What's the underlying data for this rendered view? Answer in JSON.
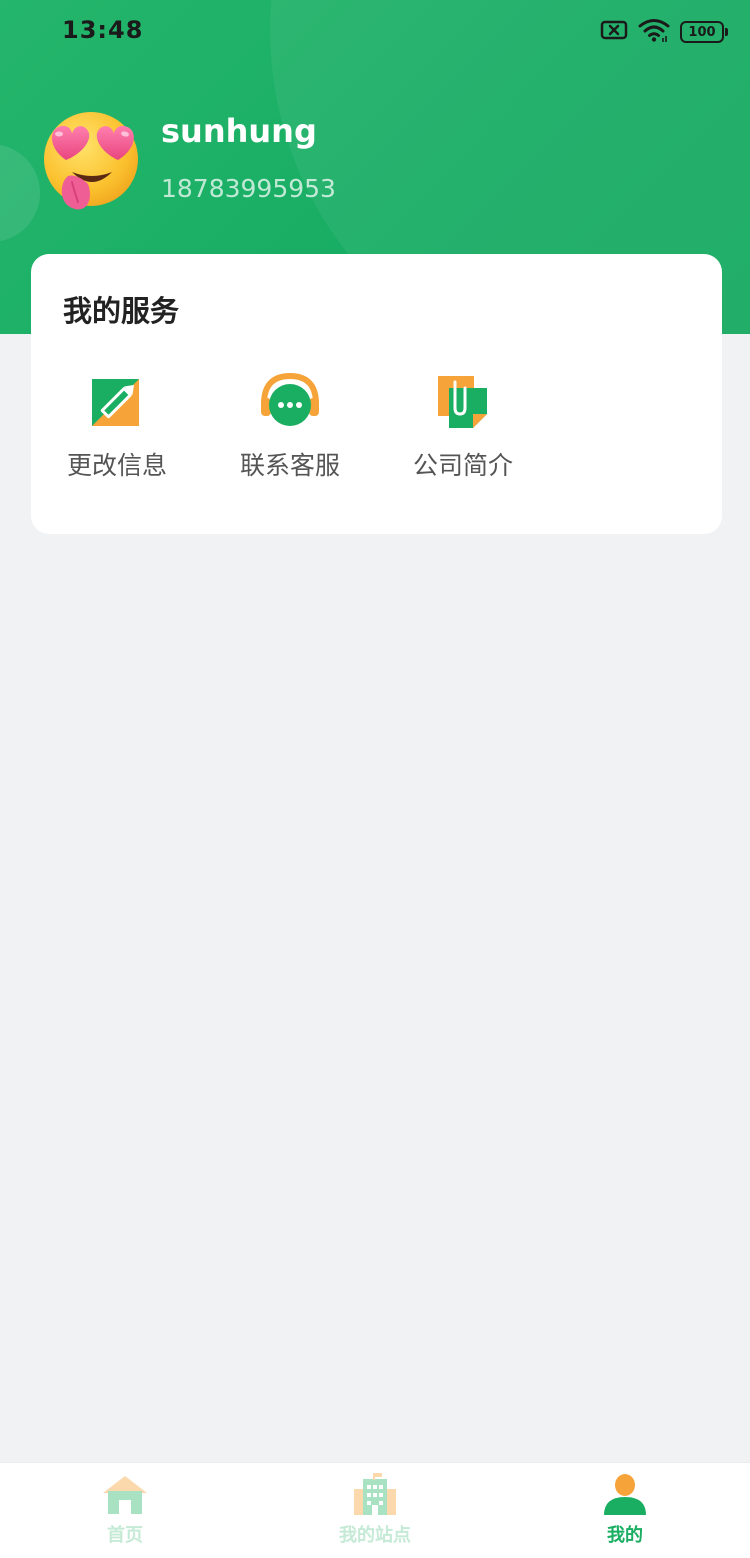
{
  "status_bar": {
    "time": "13:48",
    "battery": "100",
    "icons": [
      "sim-error-icon",
      "wifi-icon",
      "battery-icon"
    ]
  },
  "profile": {
    "username": "sunhung",
    "phone": "18783995953",
    "avatar_icon": "heart-eyes-emoji-icon"
  },
  "services": {
    "title": "我的服务",
    "items": [
      {
        "label": "更改信息",
        "icon": "edit-icon"
      },
      {
        "label": "联系客服",
        "icon": "customer-service-icon"
      },
      {
        "label": "公司简介",
        "icon": "company-profile-icon"
      }
    ]
  },
  "tabbar": {
    "items": [
      {
        "label": "首页",
        "icon": "home-icon",
        "active": false
      },
      {
        "label": "我的站点",
        "icon": "building-icon",
        "active": false
      },
      {
        "label": "我的",
        "icon": "user-icon",
        "active": true
      }
    ]
  },
  "colors": {
    "brand_green": "#1aae62",
    "accent_orange": "#f6a43a",
    "inactive_tab_text": "#c5ead6",
    "background": "#f1f2f4"
  }
}
